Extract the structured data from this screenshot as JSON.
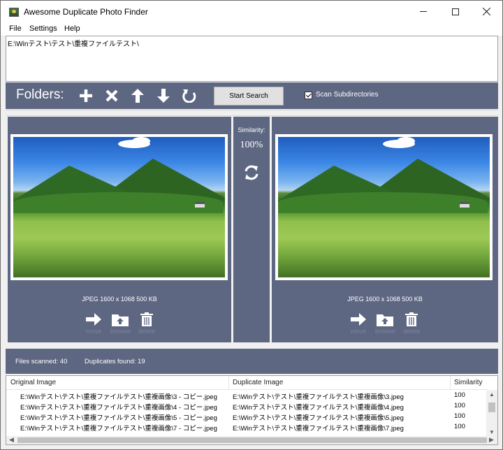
{
  "window": {
    "title": "Awesome Duplicate Photo Finder"
  },
  "menu": [
    "File",
    "Settings",
    "Help"
  ],
  "folders": {
    "path": "E:\\Winテスト\\テスト\\重複ファイルテスト\\"
  },
  "toolbar": {
    "label": "Folders:",
    "start_label": "Start Search",
    "scan_label": "Scan Subdirectories",
    "scan_checked": true
  },
  "left_image": {
    "info": "JPEG  1600 x 1068  500 KB"
  },
  "right_image": {
    "info": "JPEG  1600 x 1068  500 KB"
  },
  "actions": {
    "move": "move",
    "browse": "browse",
    "delete": "delete"
  },
  "similarity": {
    "label": "Similarity:",
    "value": "100%"
  },
  "status": {
    "files_scanned": "Files scanned: 40",
    "duplicates_found": "Duplicates found: 19"
  },
  "table": {
    "headers": [
      "Original Image",
      "Duplicate Image",
      "Similarity"
    ],
    "rows": [
      [
        "E:\\Winテスト\\テスト\\重複ファイルテスト\\重複画像\\3 - コピー.jpeg",
        "E:\\Winテスト\\テスト\\重複ファイルテスト\\重複画像\\3.jpeg",
        "100"
      ],
      [
        "E:\\Winテスト\\テスト\\重複ファイルテスト\\重複画像\\4 - コピー.jpeg",
        "E:\\Winテスト\\テスト\\重複ファイルテスト\\重複画像\\4.jpeg",
        "100"
      ],
      [
        "E:\\Winテスト\\テスト\\重複ファイルテスト\\重複画像\\5 - コピー.jpeg",
        "E:\\Winテスト\\テスト\\重複ファイルテスト\\重複画像\\5.jpeg",
        "100"
      ],
      [
        "E:\\Winテスト\\テスト\\重複ファイルテスト\\重複画像\\7 - コピー.jpeg",
        "E:\\Winテスト\\テスト\\重複ファイルテスト\\重複画像\\7.jpeg",
        "100"
      ]
    ]
  },
  "colors": {
    "panel": "#5e6782",
    "disabled_text": "#7a829c"
  }
}
